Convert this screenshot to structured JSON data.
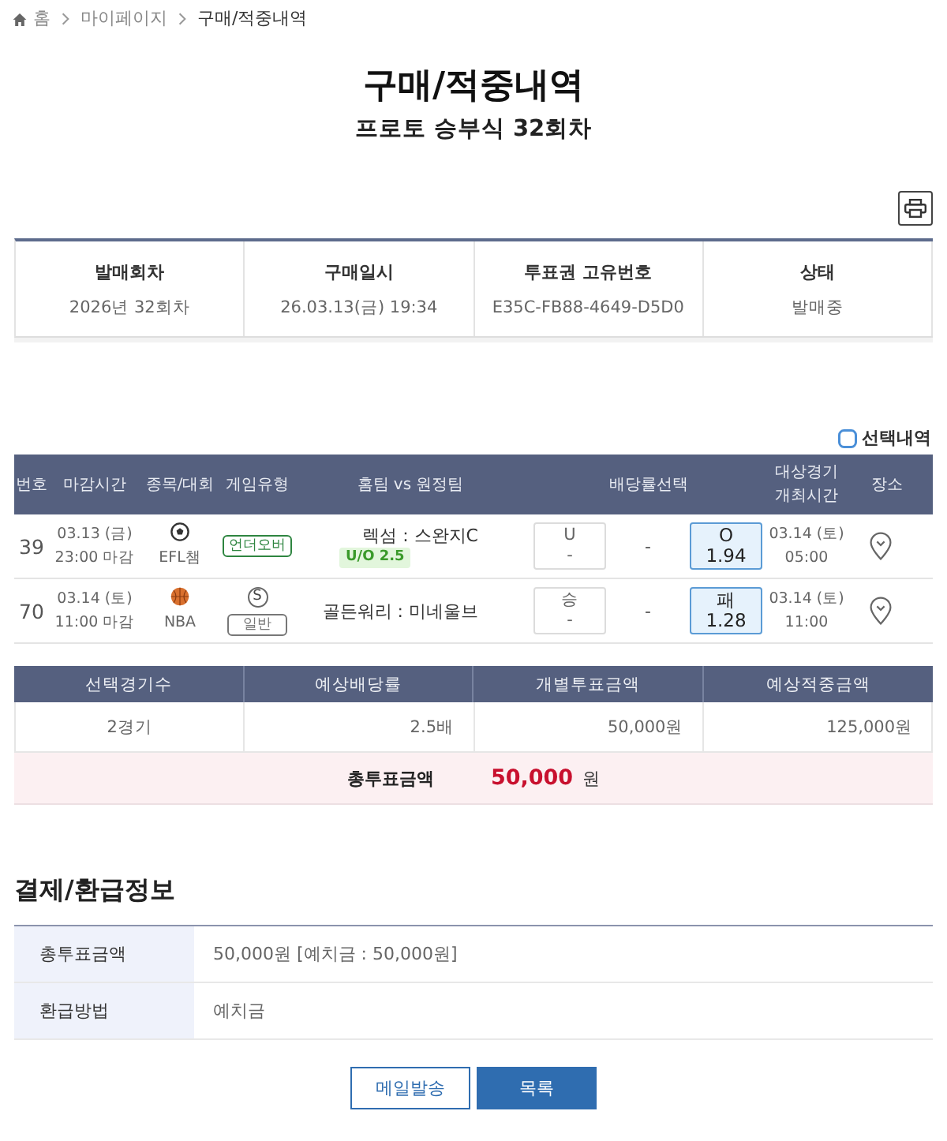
{
  "breadcrumb": [
    {
      "label": "홈",
      "kind": "home"
    },
    {
      "label": "마이페이지",
      "kind": "link"
    },
    {
      "label": "구매/적중내역",
      "kind": "current"
    }
  ],
  "title": "구매/적중내역",
  "subtitle": "프로토 승부식 32회차",
  "ticket_info": [
    {
      "label": "발매회차",
      "value": "2026년 32회차"
    },
    {
      "label": "구매일시",
      "value": "26.03.13(금) 19:34"
    },
    {
      "label": "투표권 고유번호",
      "value": "E35C-FB88-4649-D5D0"
    },
    {
      "label": "상태",
      "value": "발매중"
    }
  ],
  "selection_filter": {
    "label": "선택내역",
    "checked": false
  },
  "games": {
    "columns": [
      "번호",
      "마감시간",
      "종목/대회",
      "게임유형",
      "홈팀 vs 원정팀",
      "배당률선택",
      "대상경기 개최시간",
      "장소"
    ],
    "rows": [
      {
        "number": "39",
        "deadline_date": "03.13 (금)",
        "deadline_time": "23:00 마감",
        "kind": "soccer",
        "league": "EFL챔",
        "game_type": {
          "label": "언더오버",
          "color": "#2e8540"
        },
        "teams": "렉섬 : 스완지C",
        "handicap": "U/O 2.5",
        "odds": [
          {
            "kind": "option",
            "label": "U",
            "value": "-",
            "selected": false
          },
          {
            "kind": "none",
            "value": "-"
          },
          {
            "kind": "option",
            "label": "O",
            "value": "1.94",
            "selected": true
          }
        ],
        "match_date": "03.14 (토)",
        "match_time": "05:00"
      },
      {
        "number": "70",
        "deadline_date": "03.14 (토)",
        "deadline_time": "11:00 마감",
        "kind": "basketball",
        "league": "NBA",
        "mark": "S",
        "game_type": {
          "label": "일반",
          "color": "#777777"
        },
        "teams": "골든워리 : 미네울브",
        "odds": [
          {
            "kind": "option",
            "label": "승",
            "value": "-",
            "selected": false
          },
          {
            "kind": "none",
            "value": "-"
          },
          {
            "kind": "option",
            "label": "패",
            "value": "1.28",
            "selected": true
          }
        ],
        "match_date": "03.14 (토)",
        "match_time": "11:00"
      }
    ]
  },
  "summary": {
    "columns": [
      "선택경기수",
      "예상배당률",
      "개별투표금액",
      "예상적중금액"
    ],
    "values": [
      "2경기",
      "2.5배",
      "50,000원",
      "125,000원"
    ],
    "total": {
      "label": "총투표금액",
      "amount": "50,000",
      "unit": "원"
    }
  },
  "payment": {
    "title": "결제/환급정보",
    "rows": [
      {
        "label": "총투표금액",
        "value": "50,000원 [예치금 : 50,000원]"
      },
      {
        "label": "환급방법",
        "value": "예치금"
      }
    ]
  },
  "buttons": [
    {
      "label": "메일발송",
      "kind": "secondary"
    },
    {
      "label": "목록",
      "kind": "primary"
    }
  ]
}
